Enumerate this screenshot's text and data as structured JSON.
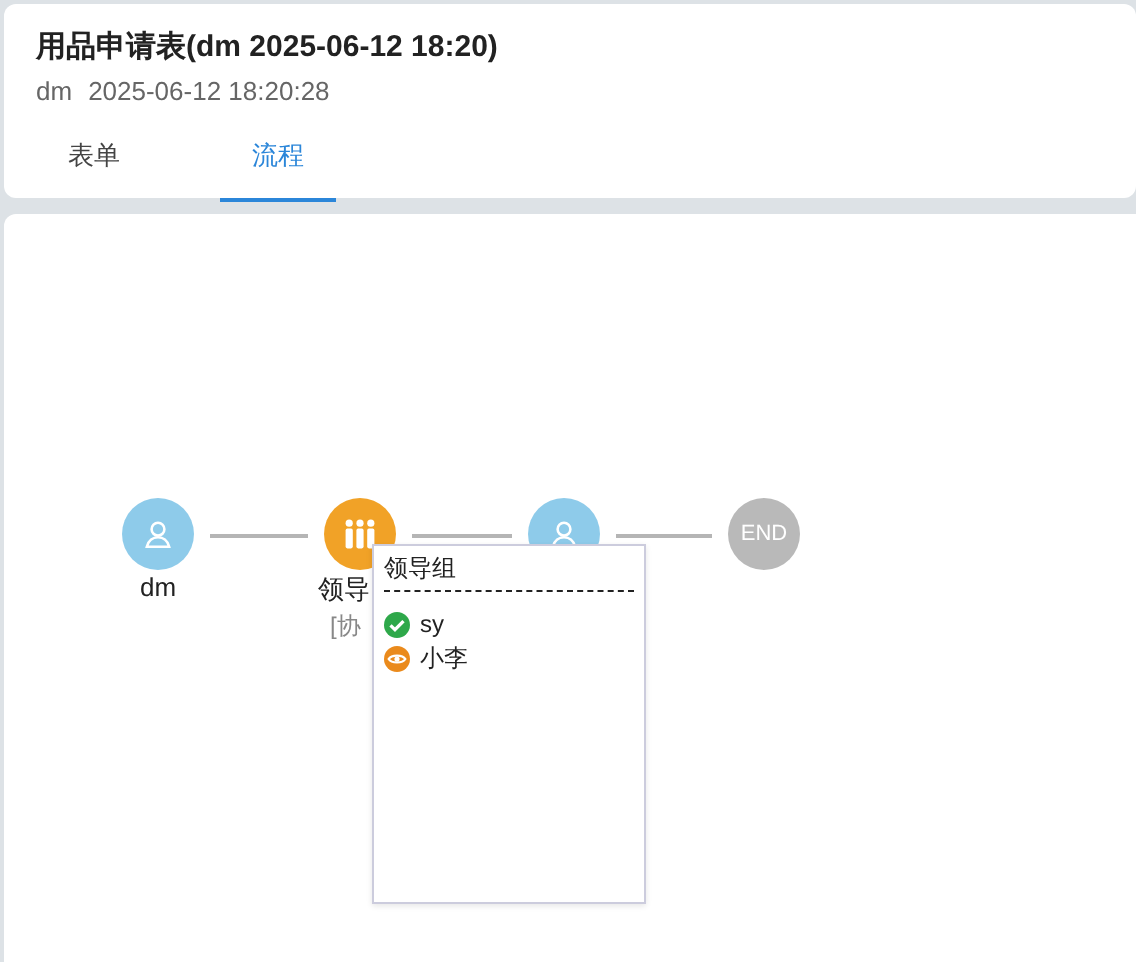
{
  "header": {
    "title": "用品申请表(dm 2025-06-12 18:20)",
    "user": "dm",
    "time": "2025-06-12 18:20:28"
  },
  "tabs": [
    {
      "label": "表单",
      "selected": false
    },
    {
      "label": "流程",
      "selected": true
    }
  ],
  "flow": {
    "nodes": [
      {
        "kind": "user",
        "label": "dm"
      },
      {
        "kind": "group",
        "label": "领导",
        "sublabel": "[协"
      },
      {
        "kind": "user"
      },
      {
        "kind": "end",
        "text": "END"
      }
    ]
  },
  "popup": {
    "title": "领导组",
    "members": [
      {
        "name": "sy",
        "done": true
      },
      {
        "name": "小李",
        "done": false
      }
    ]
  }
}
